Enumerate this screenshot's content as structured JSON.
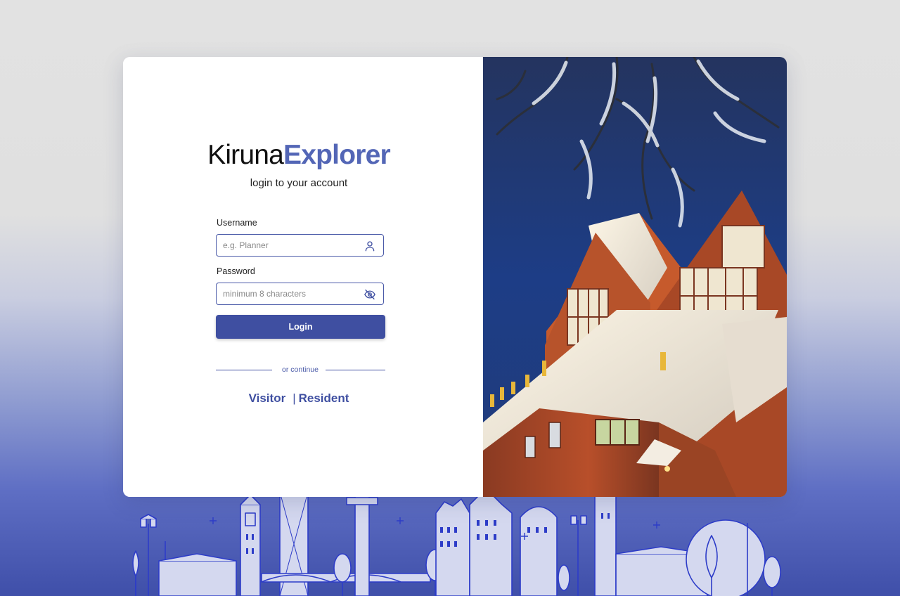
{
  "app": {
    "name_part1": "Kiruna",
    "name_part2": "Explorer",
    "subtitle": "login to your account"
  },
  "form": {
    "username_label": "Username",
    "username_placeholder": "e.g. Planner",
    "username_value": "",
    "password_label": "Password",
    "password_placeholder": "minimum 8 characters",
    "password_value": "",
    "login_label": "Login"
  },
  "alt_login": {
    "divider_text": "or continue",
    "visitor_label": "Visitor",
    "separator": "|",
    "resident_label": "Resident"
  },
  "icons": {
    "username_icon": "user-icon",
    "password_icon": "eye-off-icon"
  },
  "colors": {
    "brand": "#3f4fa1",
    "brand_light": "#5366b6",
    "skyline": "#2d3cc8"
  }
}
